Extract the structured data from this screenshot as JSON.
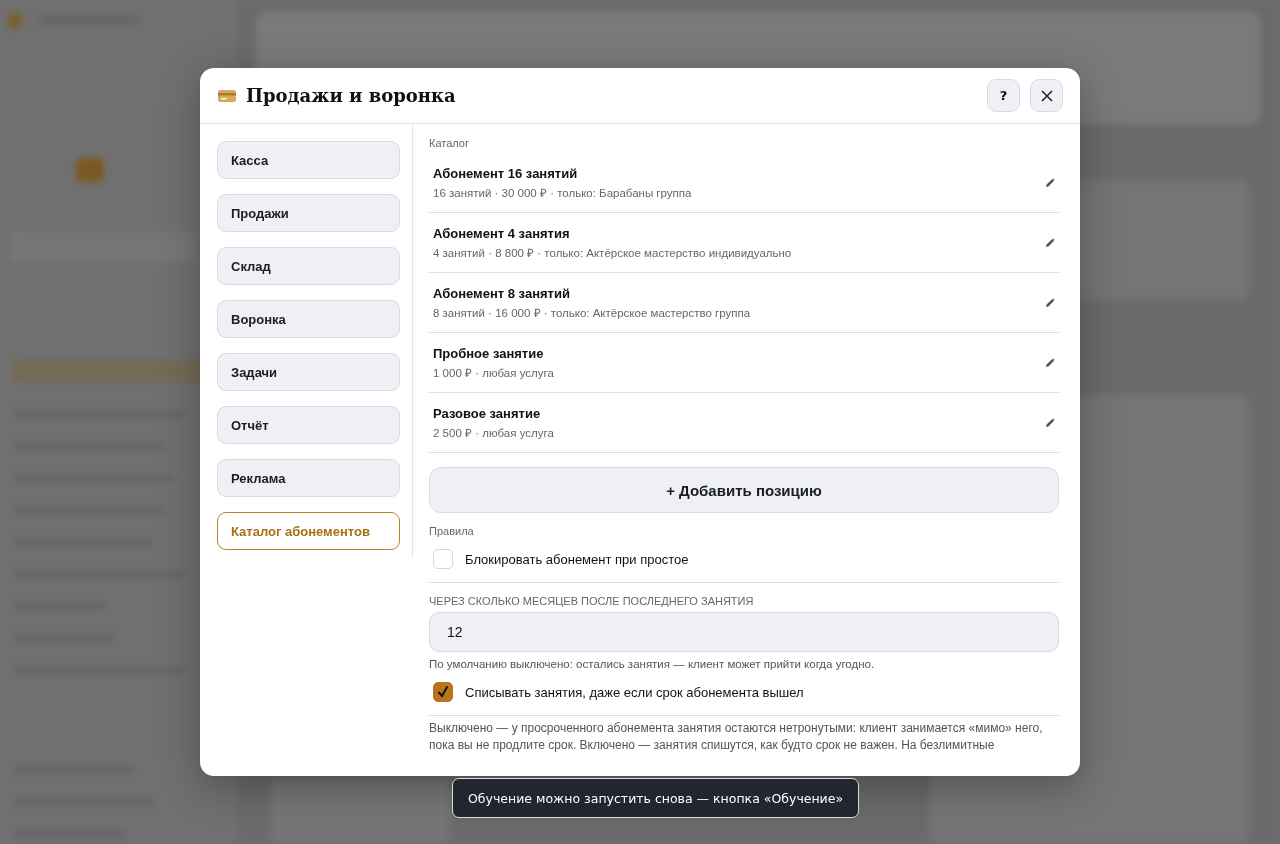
{
  "modal": {
    "title": "Продажи и воронка",
    "help_button": "?",
    "nav": [
      {
        "label": "Касса",
        "selected": false
      },
      {
        "label": "Продажи",
        "selected": false
      },
      {
        "label": "Склад",
        "selected": false
      },
      {
        "label": "Воронка",
        "selected": false
      },
      {
        "label": "Задачи",
        "selected": false
      },
      {
        "label": "Отчёт",
        "selected": false
      },
      {
        "label": "Реклама",
        "selected": false
      },
      {
        "label": "Каталог абонементов",
        "selected": true
      }
    ],
    "catalog": {
      "heading": "Каталог",
      "items": [
        {
          "name": "Абонемент 16 занятий",
          "details": "16 занятий · 30 000 ₽ · только: Барабаны группа"
        },
        {
          "name": "Абонемент 4 занятия",
          "details": "4 занятий · 8 800 ₽ · только: Актёрское мастерство индивидуально"
        },
        {
          "name": "Абонемент 8 занятий",
          "details": "8 занятий · 16 000 ₽ · только: Актёрское мастерство группа"
        },
        {
          "name": "Пробное занятие",
          "details": "1 000 ₽ · любая услуга"
        },
        {
          "name": "Разовое занятие",
          "details": "2 500 ₽ · любая услуга"
        }
      ],
      "add_button": "+ Добавить позицию"
    },
    "rules": {
      "heading": "Правила",
      "block_toggle": {
        "label": "Блокировать абонемент при простое",
        "checked": false
      },
      "months_field": {
        "label": "ЧЕРЕЗ СКОЛЬКО МЕСЯЦЕВ ПОСЛЕ ПОСЛЕДНЕГО ЗАНЯТИЯ",
        "value": "12",
        "hint": "По умолчанию выключено: остались занятия — клиент может прийти когда угодно."
      },
      "expired_toggle": {
        "label": "Списывать занятия, даже если срок абонемента вышел",
        "checked": true
      },
      "note": "Выключено — у просроченного абонемента занятия остаются нетронутыми: клиент занимается «мимо» него, пока вы не продлите срок. Включено — занятия спишутся, как будто срок не важен. На безлимитные"
    }
  },
  "toast": "Обучение можно запустить снова — кнопка «Обучение»"
}
